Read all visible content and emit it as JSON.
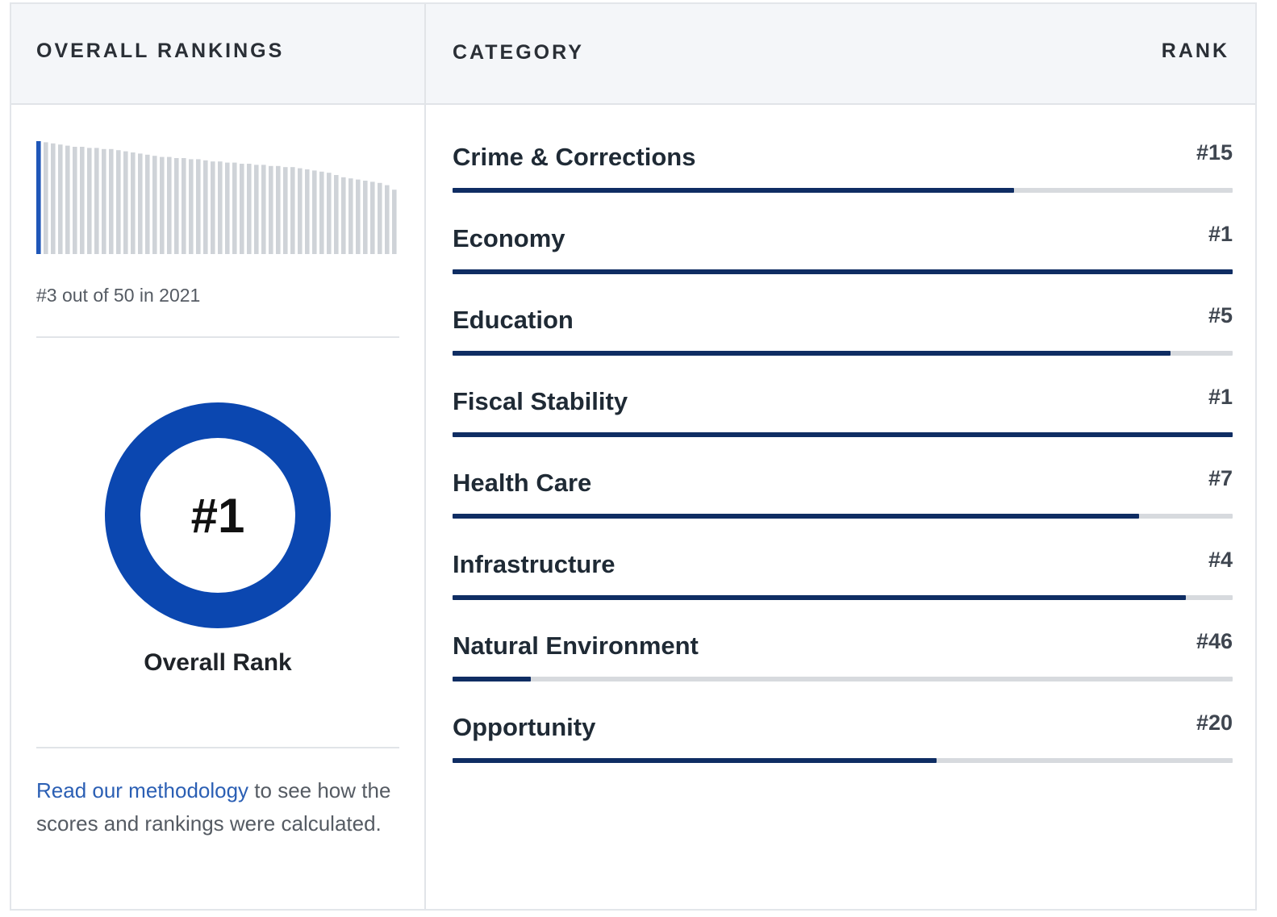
{
  "header": {
    "left_title": "OVERALL RANKINGS",
    "category_title": "CATEGORY",
    "rank_title": "RANK"
  },
  "summary": {
    "subtitle": "#3 out of 50 in 2021",
    "donut_value": "#1",
    "donut_label": "Overall Rank",
    "highlight_index": 0
  },
  "footer": {
    "link_text": "Read our methodology",
    "rest_text": " to see how the scores and rankings were calculated."
  },
  "colors": {
    "accent": "#0b47b0",
    "bar_fill": "#0f2d63",
    "track": "#d7dade",
    "mini_bar": "#cfd3d8",
    "mini_highlight": "#1f56b8"
  },
  "categories": [
    {
      "label": "Crime & Corrections",
      "rank": "#15",
      "score": 0.72
    },
    {
      "label": "Economy",
      "rank": "#1",
      "score": 1.0
    },
    {
      "label": "Education",
      "rank": "#5",
      "score": 0.92
    },
    {
      "label": "Fiscal Stability",
      "rank": "#1",
      "score": 1.0
    },
    {
      "label": "Health Care",
      "rank": "#7",
      "score": 0.88
    },
    {
      "label": "Infrastructure",
      "rank": "#4",
      "score": 0.94
    },
    {
      "label": "Natural Environment",
      "rank": "#46",
      "score": 0.1
    },
    {
      "label": "Opportunity",
      "rank": "#20",
      "score": 0.62
    }
  ],
  "chart_data": {
    "type": "bar",
    "categories": [
      "1",
      "2",
      "3",
      "4",
      "5",
      "6",
      "7",
      "8",
      "9",
      "10",
      "11",
      "12",
      "13",
      "14",
      "15",
      "16",
      "17",
      "18",
      "19",
      "20",
      "21",
      "22",
      "23",
      "24",
      "25",
      "26",
      "27",
      "28",
      "29",
      "30",
      "31",
      "32",
      "33",
      "34",
      "35",
      "36",
      "37",
      "38",
      "39",
      "40",
      "41",
      "42",
      "43",
      "44",
      "45",
      "46",
      "47",
      "48",
      "49",
      "50"
    ],
    "values": [
      100,
      99,
      98,
      97,
      96,
      95,
      95,
      94,
      94,
      93,
      93,
      92,
      91,
      90,
      89,
      88,
      87,
      86,
      86,
      85,
      85,
      84,
      84,
      83,
      82,
      82,
      81,
      81,
      80,
      80,
      79,
      79,
      78,
      78,
      77,
      77,
      76,
      75,
      74,
      73,
      72,
      70,
      68,
      67,
      66,
      65,
      64,
      63,
      61,
      57
    ],
    "title": "",
    "xlabel": "",
    "ylabel": "",
    "ylim": [
      0,
      100
    ]
  }
}
